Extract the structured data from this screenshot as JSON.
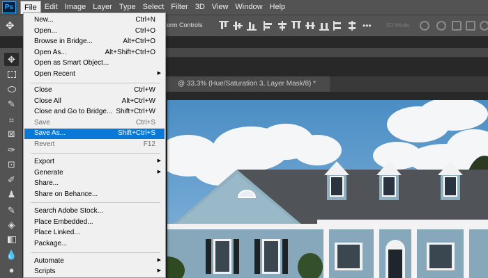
{
  "app": {
    "logo": "Ps"
  },
  "menubar": {
    "items": [
      "File",
      "Edit",
      "Image",
      "Layer",
      "Type",
      "Select",
      "Filter",
      "3D",
      "View",
      "Window",
      "Help"
    ]
  },
  "options": {
    "transform_label": "orm Controls",
    "mode_3d_label": "3D Mode:"
  },
  "document": {
    "tab_title": "@ 33.3% (Hue/Saturation 3, Layer Mask/8) *"
  },
  "file_menu": {
    "items": [
      {
        "label": "New...",
        "shortcut": "Ctrl+N"
      },
      {
        "label": "Open...",
        "shortcut": "Ctrl+O"
      },
      {
        "label": "Browse in Bridge...",
        "shortcut": "Alt+Ctrl+O"
      },
      {
        "label": "Open As...",
        "shortcut": "Alt+Shift+Ctrl+O"
      },
      {
        "label": "Open as Smart Object...",
        "shortcut": ""
      },
      {
        "label": "Open Recent",
        "shortcut": ""
      },
      {
        "label": "Close",
        "shortcut": "Ctrl+W"
      },
      {
        "label": "Close All",
        "shortcut": "Alt+Ctrl+W"
      },
      {
        "label": "Close and Go to Bridge...",
        "shortcut": "Shift+Ctrl+W"
      },
      {
        "label": "Save",
        "shortcut": "Ctrl+S"
      },
      {
        "label": "Save As...",
        "shortcut": "Shift+Ctrl+S"
      },
      {
        "label": "Revert",
        "shortcut": "F12"
      },
      {
        "label": "Export",
        "shortcut": ""
      },
      {
        "label": "Generate",
        "shortcut": ""
      },
      {
        "label": "Share...",
        "shortcut": ""
      },
      {
        "label": "Share on Behance...",
        "shortcut": ""
      },
      {
        "label": "Search Adobe Stock...",
        "shortcut": ""
      },
      {
        "label": "Place Embedded...",
        "shortcut": ""
      },
      {
        "label": "Place Linked...",
        "shortcut": ""
      },
      {
        "label": "Package...",
        "shortcut": ""
      },
      {
        "label": "Automate",
        "shortcut": ""
      },
      {
        "label": "Scripts",
        "shortcut": ""
      }
    ]
  },
  "colors": {
    "highlight": "#0a78d7",
    "menu_bg": "#f0f0f0",
    "chrome": "#535353"
  }
}
